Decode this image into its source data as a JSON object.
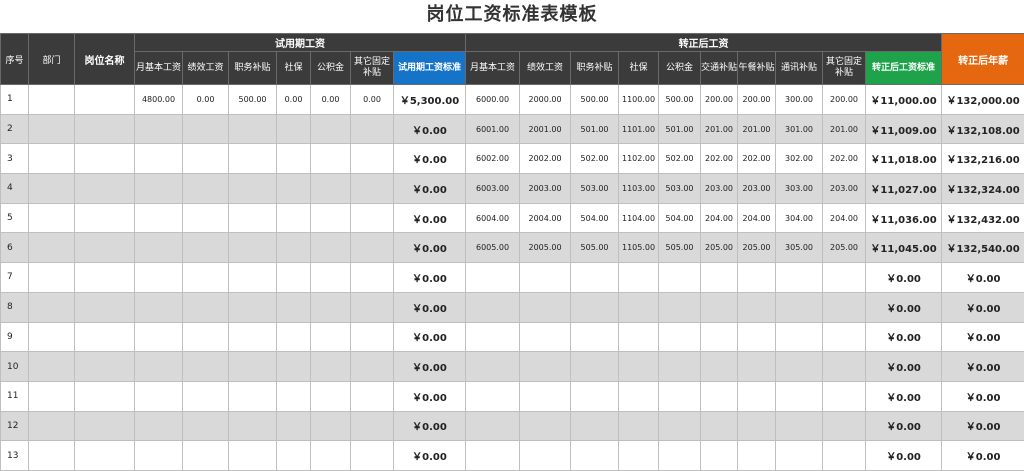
{
  "title": "岗位工资标准表模板",
  "headers": {
    "seq": "序号",
    "dept": "部门",
    "position": "岗位名称",
    "trial_group": "试用期工资",
    "formal_group": "转正后工资",
    "annual": "转正后年薪",
    "trial_cols": [
      "月基本工资",
      "绩效工资",
      "职务补贴",
      "社保",
      "公积金",
      "其它固定补贴",
      "试用期工资标准"
    ],
    "formal_cols": [
      "月基本工资",
      "绩效工资",
      "职务补贴",
      "社保",
      "公积金",
      "交通补贴",
      "午餐补贴",
      "通讯补贴",
      "其它固定补贴",
      "转正后工资标准"
    ]
  },
  "rows": [
    {
      "seq": "1",
      "dept": "",
      "position": "",
      "trial": [
        "4800.00",
        "0.00",
        "500.00",
        "0.00",
        "0.00",
        "0.00"
      ],
      "trial_total": "￥5,300.00",
      "formal": [
        "6000.00",
        "2000.00",
        "500.00",
        "1100.00",
        "500.00",
        "200.00",
        "200.00",
        "300.00",
        "200.00"
      ],
      "formal_total": "￥11,000.00",
      "annual": "￥132,000.00"
    },
    {
      "seq": "2",
      "dept": "",
      "position": "",
      "trial": [
        "",
        "",
        "",
        "",
        "",
        ""
      ],
      "trial_total": "￥0.00",
      "formal": [
        "6001.00",
        "2001.00",
        "501.00",
        "1101.00",
        "501.00",
        "201.00",
        "201.00",
        "301.00",
        "201.00"
      ],
      "formal_total": "￥11,009.00",
      "annual": "￥132,108.00"
    },
    {
      "seq": "3",
      "dept": "",
      "position": "",
      "trial": [
        "",
        "",
        "",
        "",
        "",
        ""
      ],
      "trial_total": "￥0.00",
      "formal": [
        "6002.00",
        "2002.00",
        "502.00",
        "1102.00",
        "502.00",
        "202.00",
        "202.00",
        "302.00",
        "202.00"
      ],
      "formal_total": "￥11,018.00",
      "annual": "￥132,216.00"
    },
    {
      "seq": "4",
      "dept": "",
      "position": "",
      "trial": [
        "",
        "",
        "",
        "",
        "",
        ""
      ],
      "trial_total": "￥0.00",
      "formal": [
        "6003.00",
        "2003.00",
        "503.00",
        "1103.00",
        "503.00",
        "203.00",
        "203.00",
        "303.00",
        "203.00"
      ],
      "formal_total": "￥11,027.00",
      "annual": "￥132,324.00"
    },
    {
      "seq": "5",
      "dept": "",
      "position": "",
      "trial": [
        "",
        "",
        "",
        "",
        "",
        ""
      ],
      "trial_total": "￥0.00",
      "formal": [
        "6004.00",
        "2004.00",
        "504.00",
        "1104.00",
        "504.00",
        "204.00",
        "204.00",
        "304.00",
        "204.00"
      ],
      "formal_total": "￥11,036.00",
      "annual": "￥132,432.00"
    },
    {
      "seq": "6",
      "dept": "",
      "position": "",
      "trial": [
        "",
        "",
        "",
        "",
        "",
        ""
      ],
      "trial_total": "￥0.00",
      "formal": [
        "6005.00",
        "2005.00",
        "505.00",
        "1105.00",
        "505.00",
        "205.00",
        "205.00",
        "305.00",
        "205.00"
      ],
      "formal_total": "￥11,045.00",
      "annual": "￥132,540.00"
    },
    {
      "seq": "7",
      "dept": "",
      "position": "",
      "trial": [
        "",
        "",
        "",
        "",
        "",
        ""
      ],
      "trial_total": "￥0.00",
      "formal": [
        "",
        "",
        "",
        "",
        "",
        "",
        "",
        "",
        ""
      ],
      "formal_total": "￥0.00",
      "annual": "￥0.00"
    },
    {
      "seq": "8",
      "dept": "",
      "position": "",
      "trial": [
        "",
        "",
        "",
        "",
        "",
        ""
      ],
      "trial_total": "￥0.00",
      "formal": [
        "",
        "",
        "",
        "",
        "",
        "",
        "",
        "",
        ""
      ],
      "formal_total": "￥0.00",
      "annual": "￥0.00"
    },
    {
      "seq": "9",
      "dept": "",
      "position": "",
      "trial": [
        "",
        "",
        "",
        "",
        "",
        ""
      ],
      "trial_total": "￥0.00",
      "formal": [
        "",
        "",
        "",
        "",
        "",
        "",
        "",
        "",
        ""
      ],
      "formal_total": "￥0.00",
      "annual": "￥0.00"
    },
    {
      "seq": "10",
      "dept": "",
      "position": "",
      "trial": [
        "",
        "",
        "",
        "",
        "",
        ""
      ],
      "trial_total": "￥0.00",
      "formal": [
        "",
        "",
        "",
        "",
        "",
        "",
        "",
        "",
        ""
      ],
      "formal_total": "￥0.00",
      "annual": "￥0.00"
    },
    {
      "seq": "11",
      "dept": "",
      "position": "",
      "trial": [
        "",
        "",
        "",
        "",
        "",
        ""
      ],
      "trial_total": "￥0.00",
      "formal": [
        "",
        "",
        "",
        "",
        "",
        "",
        "",
        "",
        ""
      ],
      "formal_total": "￥0.00",
      "annual": "￥0.00"
    },
    {
      "seq": "12",
      "dept": "",
      "position": "",
      "trial": [
        "",
        "",
        "",
        "",
        "",
        ""
      ],
      "trial_total": "￥0.00",
      "formal": [
        "",
        "",
        "",
        "",
        "",
        "",
        "",
        "",
        ""
      ],
      "formal_total": "￥0.00",
      "annual": "￥0.00"
    },
    {
      "seq": "13",
      "dept": "",
      "position": "",
      "trial": [
        "",
        "",
        "",
        "",
        "",
        ""
      ],
      "trial_total": "￥0.00",
      "formal": [
        "",
        "",
        "",
        "",
        "",
        "",
        "",
        "",
        ""
      ],
      "formal_total": "￥0.00",
      "annual": "￥0.00"
    }
  ],
  "colors": {
    "header_bg": "#3b3b3b",
    "trial_total_bg": "#1674c8",
    "formal_total_bg": "#1ea34b",
    "annual_bg": "#e5670f",
    "row_alt_bg": "#d9d9d9"
  }
}
